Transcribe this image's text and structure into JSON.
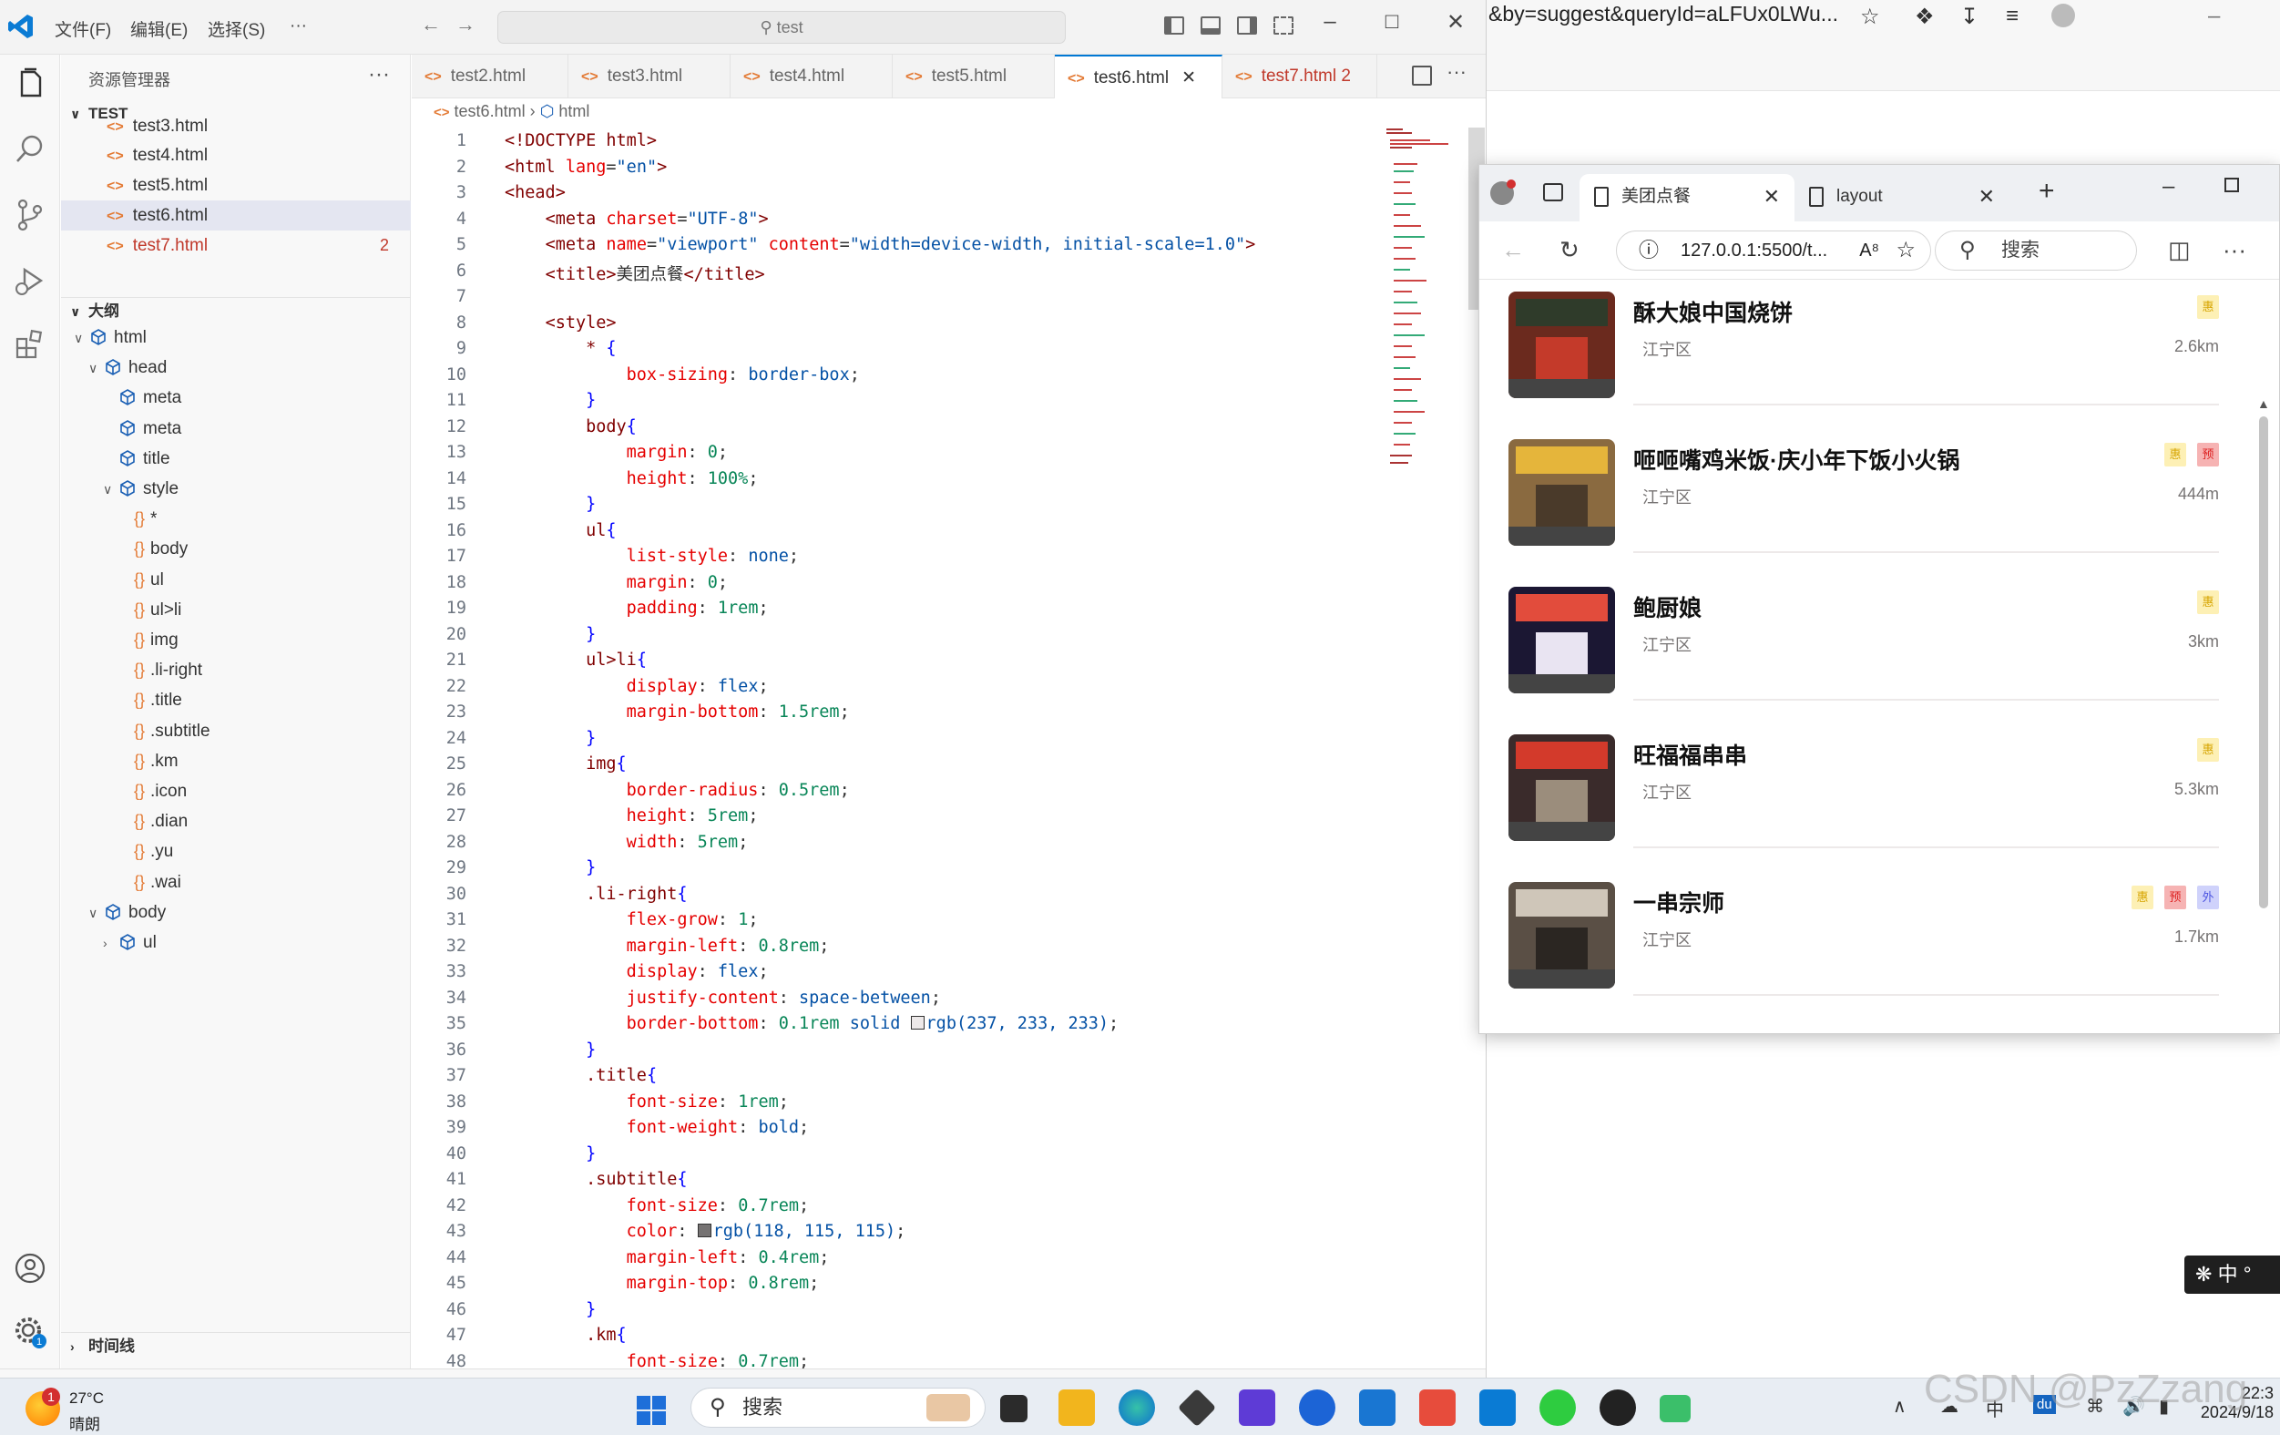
{
  "vscode": {
    "menu": [
      "文件(F)",
      "编辑(E)",
      "选择(S)",
      "···"
    ],
    "command_center": "test",
    "explorer_title": "资源管理器",
    "explorer_dots": "···",
    "section_test": "TEST",
    "files": [
      {
        "name": "test3.html",
        "badge": ""
      },
      {
        "name": "test4.html",
        "badge": ""
      },
      {
        "name": "test5.html",
        "badge": ""
      },
      {
        "name": "test6.html",
        "badge": ""
      },
      {
        "name": "test7.html",
        "badge": "2"
      }
    ],
    "section_outline": "大纲",
    "outline": [
      "html",
      "head",
      "meta",
      "meta",
      "title",
      "style",
      "*",
      "body",
      "ul",
      "ul>li",
      "img",
      ".li-right",
      ".title",
      ".subtitle",
      ".km",
      ".icon",
      ".dian",
      ".yu",
      ".wai",
      "body",
      "ul"
    ],
    "section_timeline": "时间线",
    "tabs": [
      {
        "label": "test2.html",
        "badge": ""
      },
      {
        "label": "test3.html",
        "badge": ""
      },
      {
        "label": "test4.html",
        "badge": ""
      },
      {
        "label": "test5.html",
        "badge": ""
      },
      {
        "label": "test6.html",
        "badge": ""
      },
      {
        "label": "test7.html",
        "badge": "2"
      }
    ],
    "breadcrumb": [
      "test6.html",
      "html"
    ],
    "line_numbers": [
      "1",
      "2",
      "3",
      "4",
      "5",
      "6",
      "7",
      "8",
      "9",
      "10",
      "11",
      "12",
      "13",
      "14",
      "15",
      "16",
      "17",
      "18",
      "19",
      "20",
      "21",
      "22",
      "23",
      "24",
      "25",
      "26",
      "27",
      "28",
      "29",
      "30",
      "31",
      "32",
      "33",
      "34",
      "35",
      "36",
      "37",
      "38",
      "39",
      "40",
      "41",
      "42",
      "43",
      "44",
      "45",
      "46",
      "47",
      "48"
    ],
    "code": {
      "doctype": "<!DOCTYPE html>",
      "html_open": "<html",
      "lang_attr": "lang",
      "lang_val": "\"en\"",
      "head_open": "<head>",
      "meta1": "<meta",
      "charset_attr": "charset",
      "charset_val": "\"UTF-8\"",
      "meta2_name_attr": "name",
      "meta2_name_val": "\"viewport\"",
      "meta2_content_attr": "content",
      "meta2_content_val": "\"width=device-width, initial-scale=1.0\"",
      "title_open": "<title>",
      "title_text": "美团点餐",
      "title_close": "</title>",
      "style_open": "<style>",
      "star": "*",
      "box_sizing": "box-sizing",
      "border_box": "border-box",
      "body_sel": "body",
      "margin": "margin",
      "zero": "0",
      "height": "height",
      "h100": "100%",
      "ul_sel": "ul",
      "list_style": "list-style",
      "none": "none",
      "padding": "padding",
      "rem1": "1rem",
      "ulli_sel": "ul>li",
      "display": "display",
      "flex": "flex",
      "margin_bottom": "margin-bottom",
      "rem15": "1.5rem",
      "img_sel": "img",
      "border_radius": "border-radius",
      "rem05": "0.5rem",
      "rem5": "5rem",
      "width": "width",
      "liright_sel": ".li-right",
      "flex_grow": "flex-grow",
      "one": "1",
      "margin_left": "margin-left",
      "rem08": "0.8rem",
      "justify_content": "justify-content",
      "space_between": "space-between",
      "border_bottom": "border-bottom",
      "rem01": "0.1rem",
      "solid": "solid",
      "rgb1": "rgb(237, 233, 233)",
      "title_sel": ".title",
      "font_size": "font-size",
      "font_weight": "font-weight",
      "bold": "bold",
      "subtitle_sel": ".subtitle",
      "rem07": "0.7rem",
      "color": "color",
      "rgb2": "rgb(118, 115, 115)",
      "rem04": "0.4rem",
      "margin_top": "margin-top",
      "km_sel": ".km"
    }
  },
  "bg_browser": {
    "url_fragment": "&by=suggest&queryId=aLFUx0LWu..."
  },
  "edge": {
    "tabs": [
      {
        "label": "美团点餐"
      },
      {
        "label": "layout"
      }
    ],
    "address": "127.0.0.1:5500/t...",
    "search_placeholder": "搜索",
    "shops": [
      {
        "name": "酥大娘中国烧饼",
        "area": "江宁区",
        "distance": "2.6km",
        "icons": [
          "yu"
        ]
      },
      {
        "name": "咂咂嘴鸡米饭·庆小年下饭小火锅",
        "area": "江宁区",
        "distance": "444m",
        "icons": [
          "yu",
          "yy"
        ]
      },
      {
        "name": "鲍厨娘",
        "area": "江宁区",
        "distance": "3km",
        "icons": [
          "yu"
        ]
      },
      {
        "name": "旺福福串串",
        "area": "江宁区",
        "distance": "5.3km",
        "icons": [
          "yu"
        ]
      },
      {
        "name": "一串宗师",
        "area": "江宁区",
        "distance": "1.7km",
        "icons": [
          "yu",
          "yy",
          "wai"
        ]
      }
    ],
    "icon_labels": {
      "yu": "惠",
      "yy": "预",
      "wai": "外"
    }
  },
  "ime": {
    "label": "中"
  },
  "taskbar": {
    "temperature": "27°C",
    "condition": "晴朗",
    "search_label": "搜索",
    "time": "22:3",
    "date": "2024/9/18"
  },
  "watermark": "CSDN @PzZzang"
}
